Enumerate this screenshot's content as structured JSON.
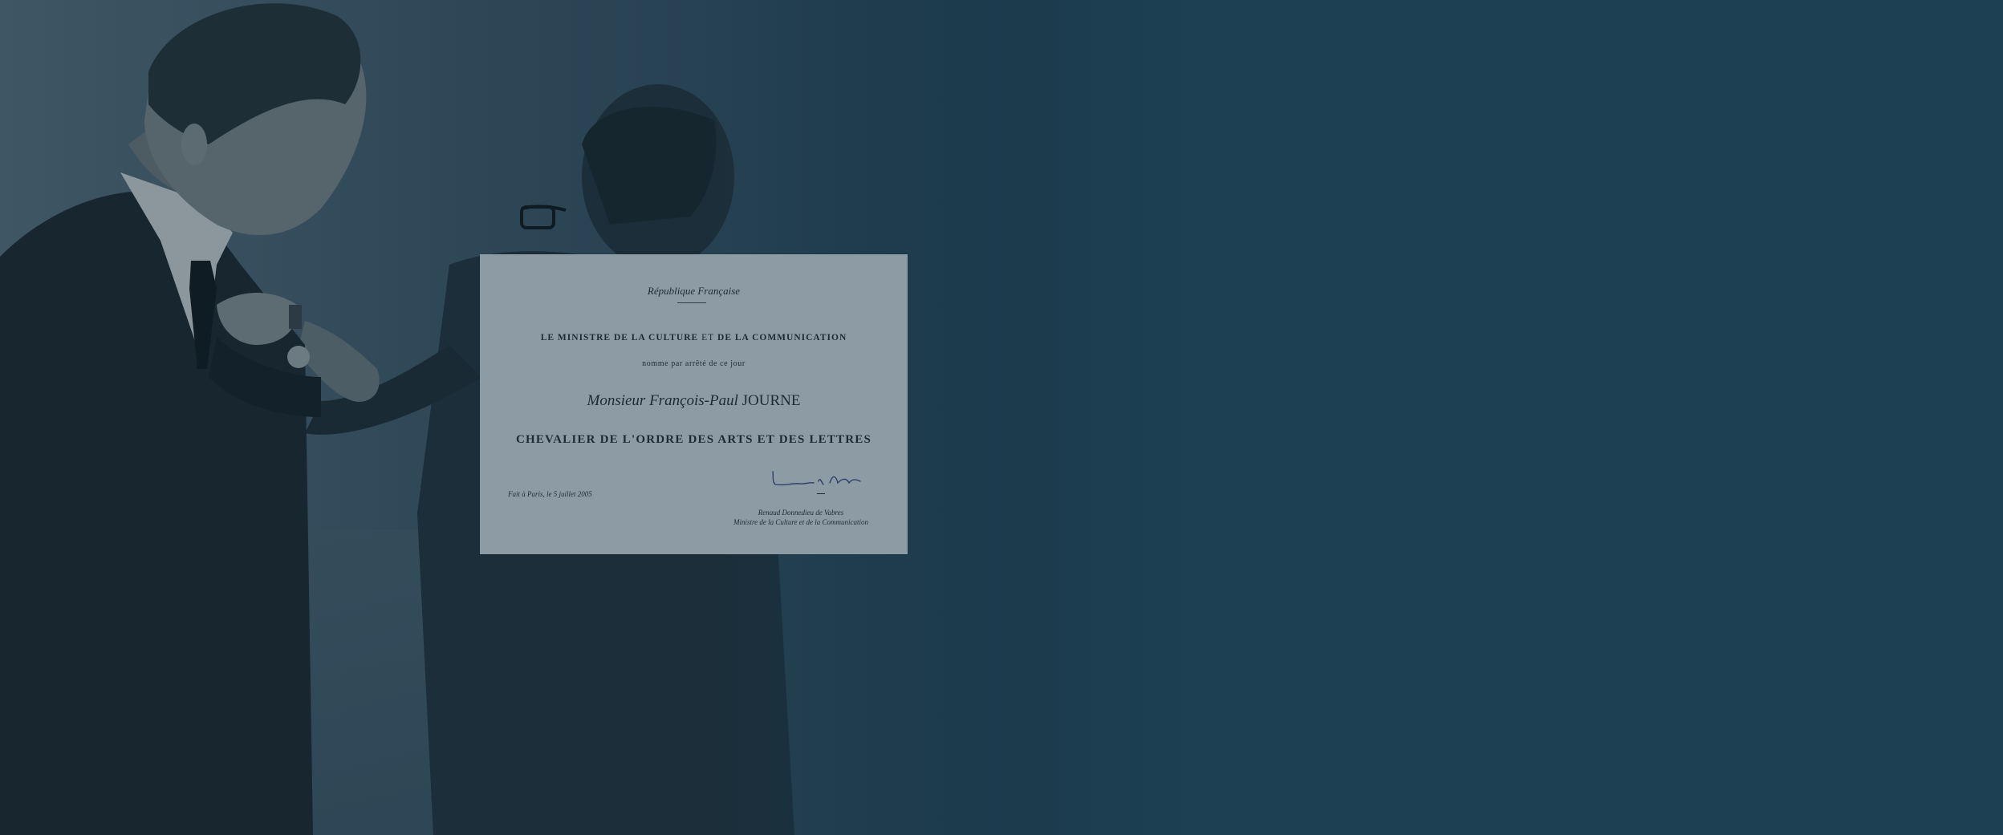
{
  "certificate": {
    "header": "République Française",
    "ministry_part1": "LE MINISTRE DE LA CULTURE",
    "ministry_et": "ET",
    "ministry_part2": "DE LA COMMUNICATION",
    "appointment_text": "nomme par arrêté de ce jour",
    "name_prefix": "Monsieur François-Paul",
    "name_surname": "JOURNE",
    "honour_title": "CHEVALIER DE L'ORDRE DES ARTS ET DES LETTRES",
    "place_date": "Fait à Paris, le 5 juillet 2005",
    "signer_name": "Renaud Donnedieu de Vabres",
    "signer_role": "Ministre de la Culture et de la Communication"
  },
  "colors": {
    "background": "#1d3e51",
    "certificate_paper": "#8d9ca4",
    "ink": "#1e2a33",
    "signature_ink": "#2c3f6e"
  }
}
